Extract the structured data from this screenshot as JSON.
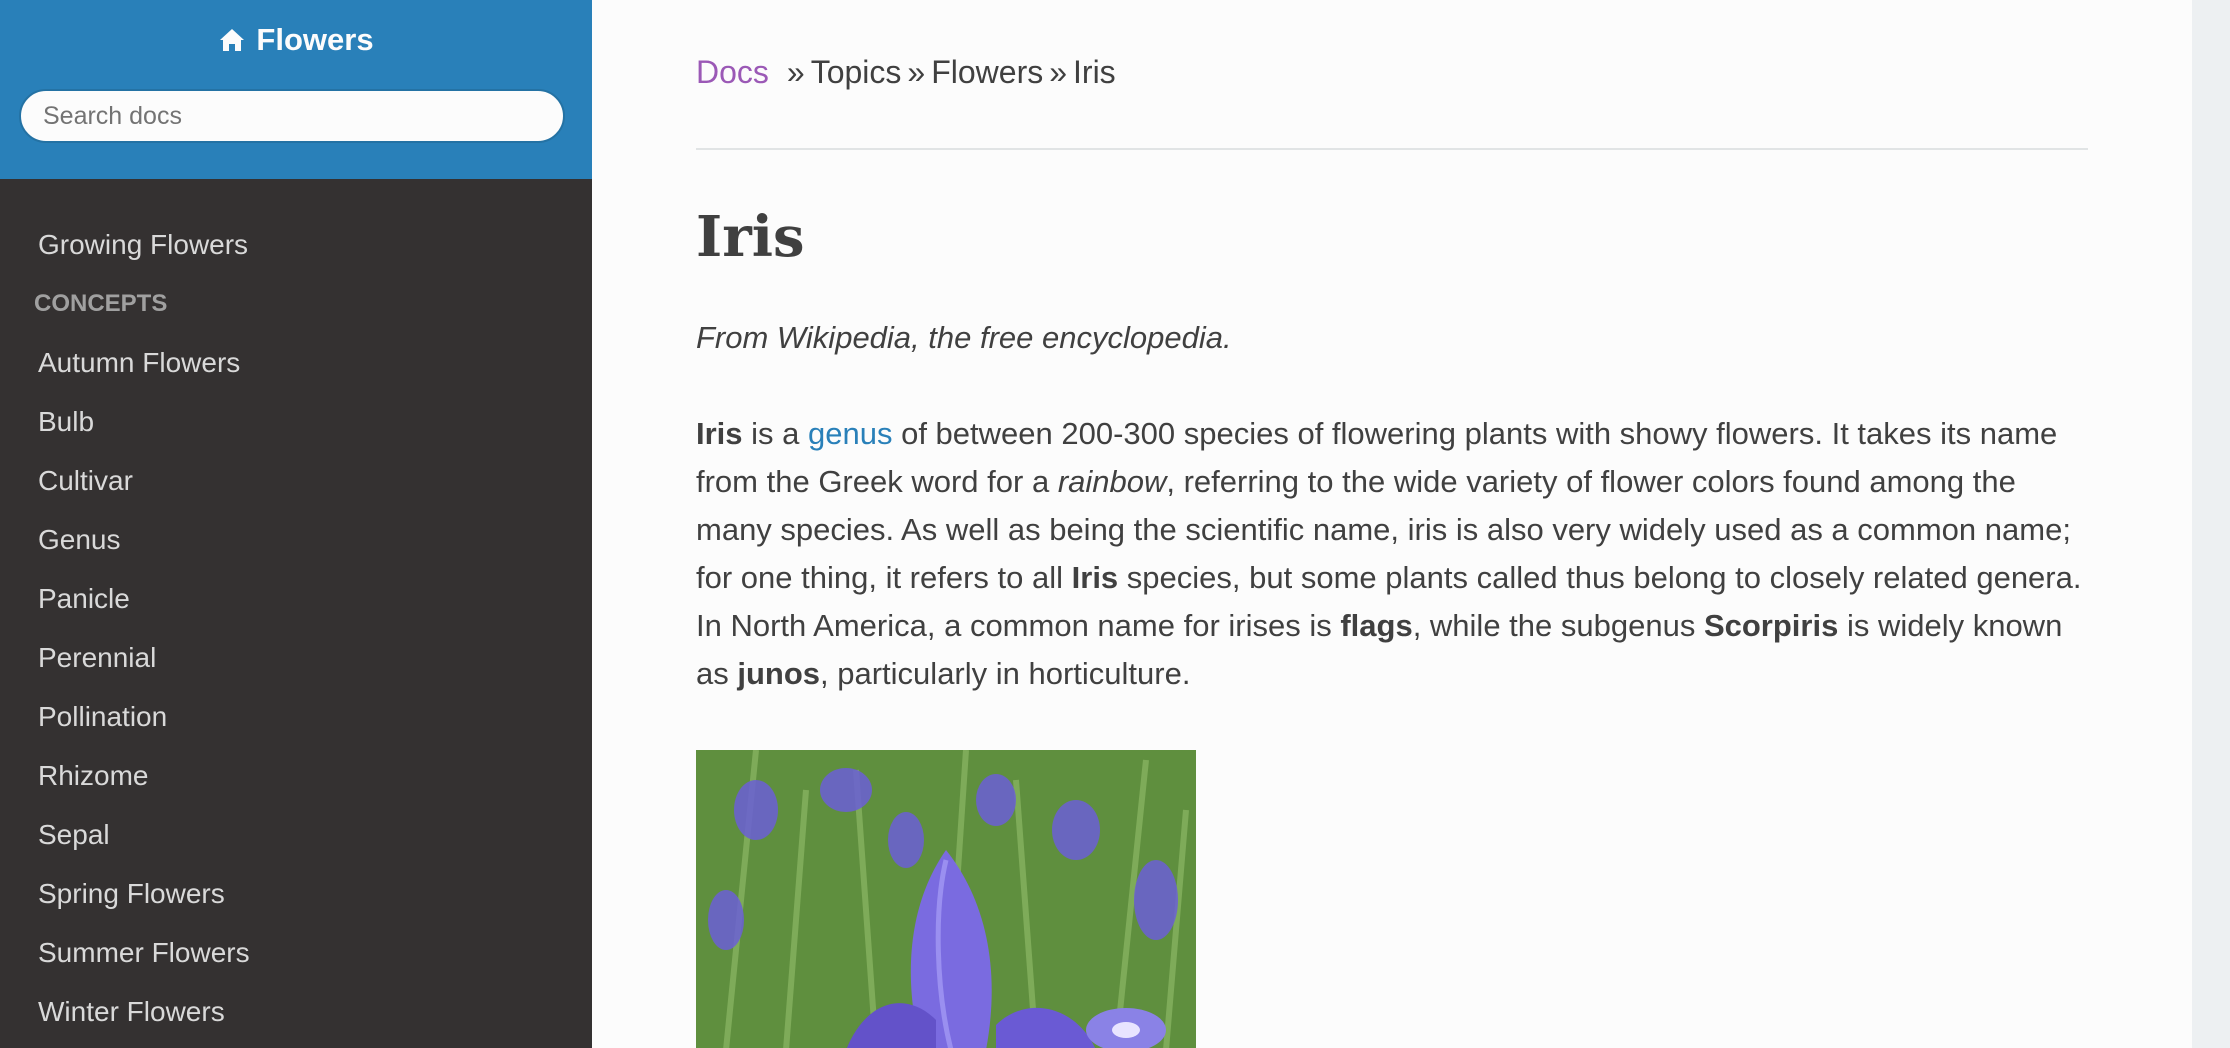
{
  "sidebar": {
    "project_name": "Flowers",
    "search_placeholder": "Search docs",
    "top_item": "Growing Flowers",
    "caption": "Concepts",
    "items": [
      "Autumn Flowers",
      "Bulb",
      "Cultivar",
      "Genus",
      "Panicle",
      "Perennial",
      "Pollination",
      "Rhizome",
      "Sepal",
      "Spring Flowers",
      "Summer Flowers",
      "Winter Flowers"
    ]
  },
  "breadcrumb": {
    "docs": "Docs",
    "sep": "»",
    "topics": "Topics",
    "flowers": "Flowers",
    "current": "Iris"
  },
  "page": {
    "title": "Iris",
    "subtitle": "From Wikipedia, the free encyclopedia.",
    "p": {
      "s1": "Iris",
      "s2": " is a ",
      "s3": "genus",
      "s4": " of between 200-300 species of flowering plants with showy flowers. It takes its name from the Greek word for a ",
      "s5": "rainbow",
      "s6": ", referring to the wide variety of flower colors found among the many species. As well as being the scientific name, iris is also very widely used as a common name; for one thing, it refers to all ",
      "s7": "Iris",
      "s8": " species, but some plants called thus belong to closely related genera. In North America, a common name for irises is ",
      "s9": "flags",
      "s10": ", while the subgenus ",
      "s11": "Scorpiris",
      "s12": " is widely known as ",
      "s13": "junos",
      "s14": ", particularly in horticulture."
    }
  },
  "colors": {
    "sidebar_top": "#2980b9",
    "sidebar_bg": "#343131",
    "link": "#2980b9",
    "visited_link": "#9b59b6",
    "text": "#404040"
  }
}
